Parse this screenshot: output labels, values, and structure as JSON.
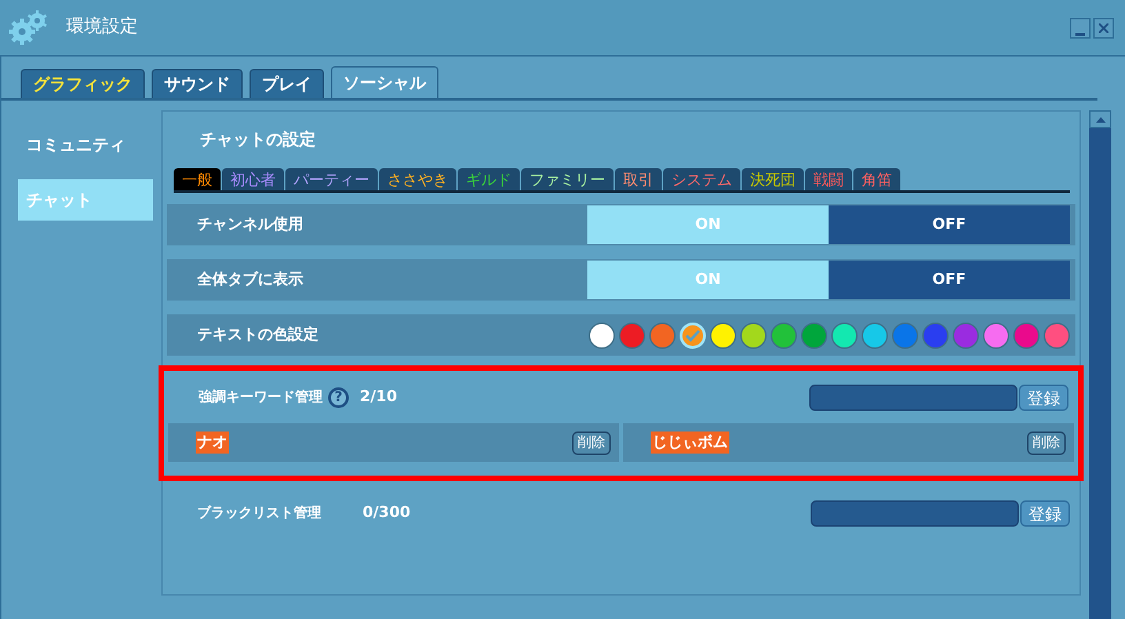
{
  "window": {
    "title": "環境設定"
  },
  "tabs": [
    {
      "label": "グラフィック",
      "selected": false,
      "kind": "accent"
    },
    {
      "label": "サウンド",
      "selected": false,
      "kind": "plain"
    },
    {
      "label": "プレイ",
      "selected": false,
      "kind": "plain"
    },
    {
      "label": "ソーシャル",
      "selected": true,
      "kind": "plain"
    }
  ],
  "sidebar": {
    "items": [
      {
        "label": "コミュニティ",
        "selected": false
      },
      {
        "label": "チャット",
        "selected": true
      }
    ]
  },
  "section_title": "チャットの設定",
  "chat_tabs": [
    {
      "label": "一般",
      "kind": "general",
      "selected": true
    },
    {
      "label": "初心者",
      "kind": "beginner",
      "selected": false
    },
    {
      "label": "パーティー",
      "kind": "party",
      "selected": false
    },
    {
      "label": "ささやき",
      "kind": "whisper",
      "selected": false
    },
    {
      "label": "ギルド",
      "kind": "guild",
      "selected": false
    },
    {
      "label": "ファミリー",
      "kind": "family",
      "selected": false
    },
    {
      "label": "取引",
      "kind": "trade",
      "selected": false
    },
    {
      "label": "システム",
      "kind": "system",
      "selected": false
    },
    {
      "label": "決死団",
      "kind": "squad",
      "selected": false
    },
    {
      "label": "戦闘",
      "kind": "battle",
      "selected": false
    },
    {
      "label": "角笛",
      "kind": "horn",
      "selected": false
    }
  ],
  "settings": [
    {
      "kind": "toggle",
      "label": "チャンネル使用",
      "on_label": "ON",
      "off_label": "OFF",
      "on": true
    },
    {
      "kind": "toggle",
      "label": "全体タブに表示",
      "on_label": "ON",
      "off_label": "OFF",
      "on": true
    },
    {
      "kind": "colors",
      "label": "テキストの色設定",
      "swatches": [
        {
          "color": "#ffffff",
          "selected": false
        },
        {
          "color": "#ed1c24",
          "selected": false
        },
        {
          "color": "#f26522",
          "selected": false
        },
        {
          "color": "#f7941d",
          "selected": true
        },
        {
          "color": "#fff200",
          "selected": false
        },
        {
          "color": "#a3d81c",
          "selected": false
        },
        {
          "color": "#22c13a",
          "selected": false
        },
        {
          "color": "#00a63c",
          "selected": false
        },
        {
          "color": "#13e8b0",
          "selected": false
        },
        {
          "color": "#17c8e8",
          "selected": false
        },
        {
          "color": "#0a75e8",
          "selected": false
        },
        {
          "color": "#2a3ef0",
          "selected": false
        },
        {
          "color": "#9a2ce0",
          "selected": false
        },
        {
          "color": "#f66cf0",
          "selected": false
        },
        {
          "color": "#ea0a8c",
          "selected": false
        },
        {
          "color": "#ff4f80",
          "selected": false
        }
      ]
    }
  ],
  "keywords": {
    "label": "強調キーワード管理",
    "help": "?",
    "count": "2/10",
    "button": "登録",
    "items": [
      {
        "text": "ナオ",
        "delete": "削除"
      },
      {
        "text": "じじぃボム",
        "delete": "削除"
      }
    ]
  },
  "blacklist": {
    "label": "ブラックリスト管理",
    "count": "0/300",
    "button": "登録"
  }
}
